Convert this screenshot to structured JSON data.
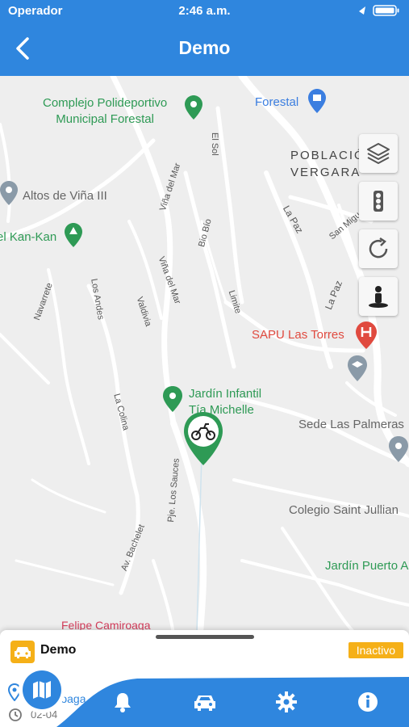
{
  "status": {
    "carrier": "Operador",
    "time": "2:46 a.m."
  },
  "header": {
    "title": "Demo"
  },
  "map": {
    "pois": [
      {
        "key": "complejo",
        "text": "Complejo Polideportivo\nMunicipal Forestal"
      },
      {
        "key": "forestal",
        "text": "Forestal"
      },
      {
        "key": "poblacion",
        "text": "POBLACIÓN\nVERGARA"
      },
      {
        "key": "altos",
        "text": "Altos de Viña III"
      },
      {
        "key": "kankan",
        "text": "el Kan-Kan"
      },
      {
        "key": "sapu",
        "text": "SAPU Las Torres"
      },
      {
        "key": "jardin",
        "text": "Jardín Infantil\nTía Michelle"
      },
      {
        "key": "sede",
        "text": "Sede Las Palmeras"
      },
      {
        "key": "colegio",
        "text": "Colegio Saint Jullian"
      },
      {
        "key": "jardinpuerto",
        "text": "Jardín Puerto A"
      },
      {
        "key": "felipe",
        "text": "Felipe Camiroaga"
      }
    ],
    "streets": [
      "El Sol",
      "Viña del Mar",
      "Bio Bío",
      "Valdivia",
      "Viña del Mar",
      "Navarrete",
      "Los Andes",
      "Limite",
      "La Paz",
      "La Paz",
      "San Miguel",
      "La Colina",
      "Pje. Los Sauces",
      "Av. Bachelet"
    ]
  },
  "controls": [
    "layers-icon",
    "traffic-icon",
    "refresh-icon",
    "streetview-icon"
  ],
  "vehicle": {
    "name": "Demo",
    "status": "Inactivo",
    "address": "Felipe\nCamiroaga",
    "date": "02-04"
  },
  "colors": {
    "primary": "#2f86de",
    "accent": "#f5b018",
    "poi_green": "#2e9a55",
    "poi_red": "#e04a3f"
  }
}
